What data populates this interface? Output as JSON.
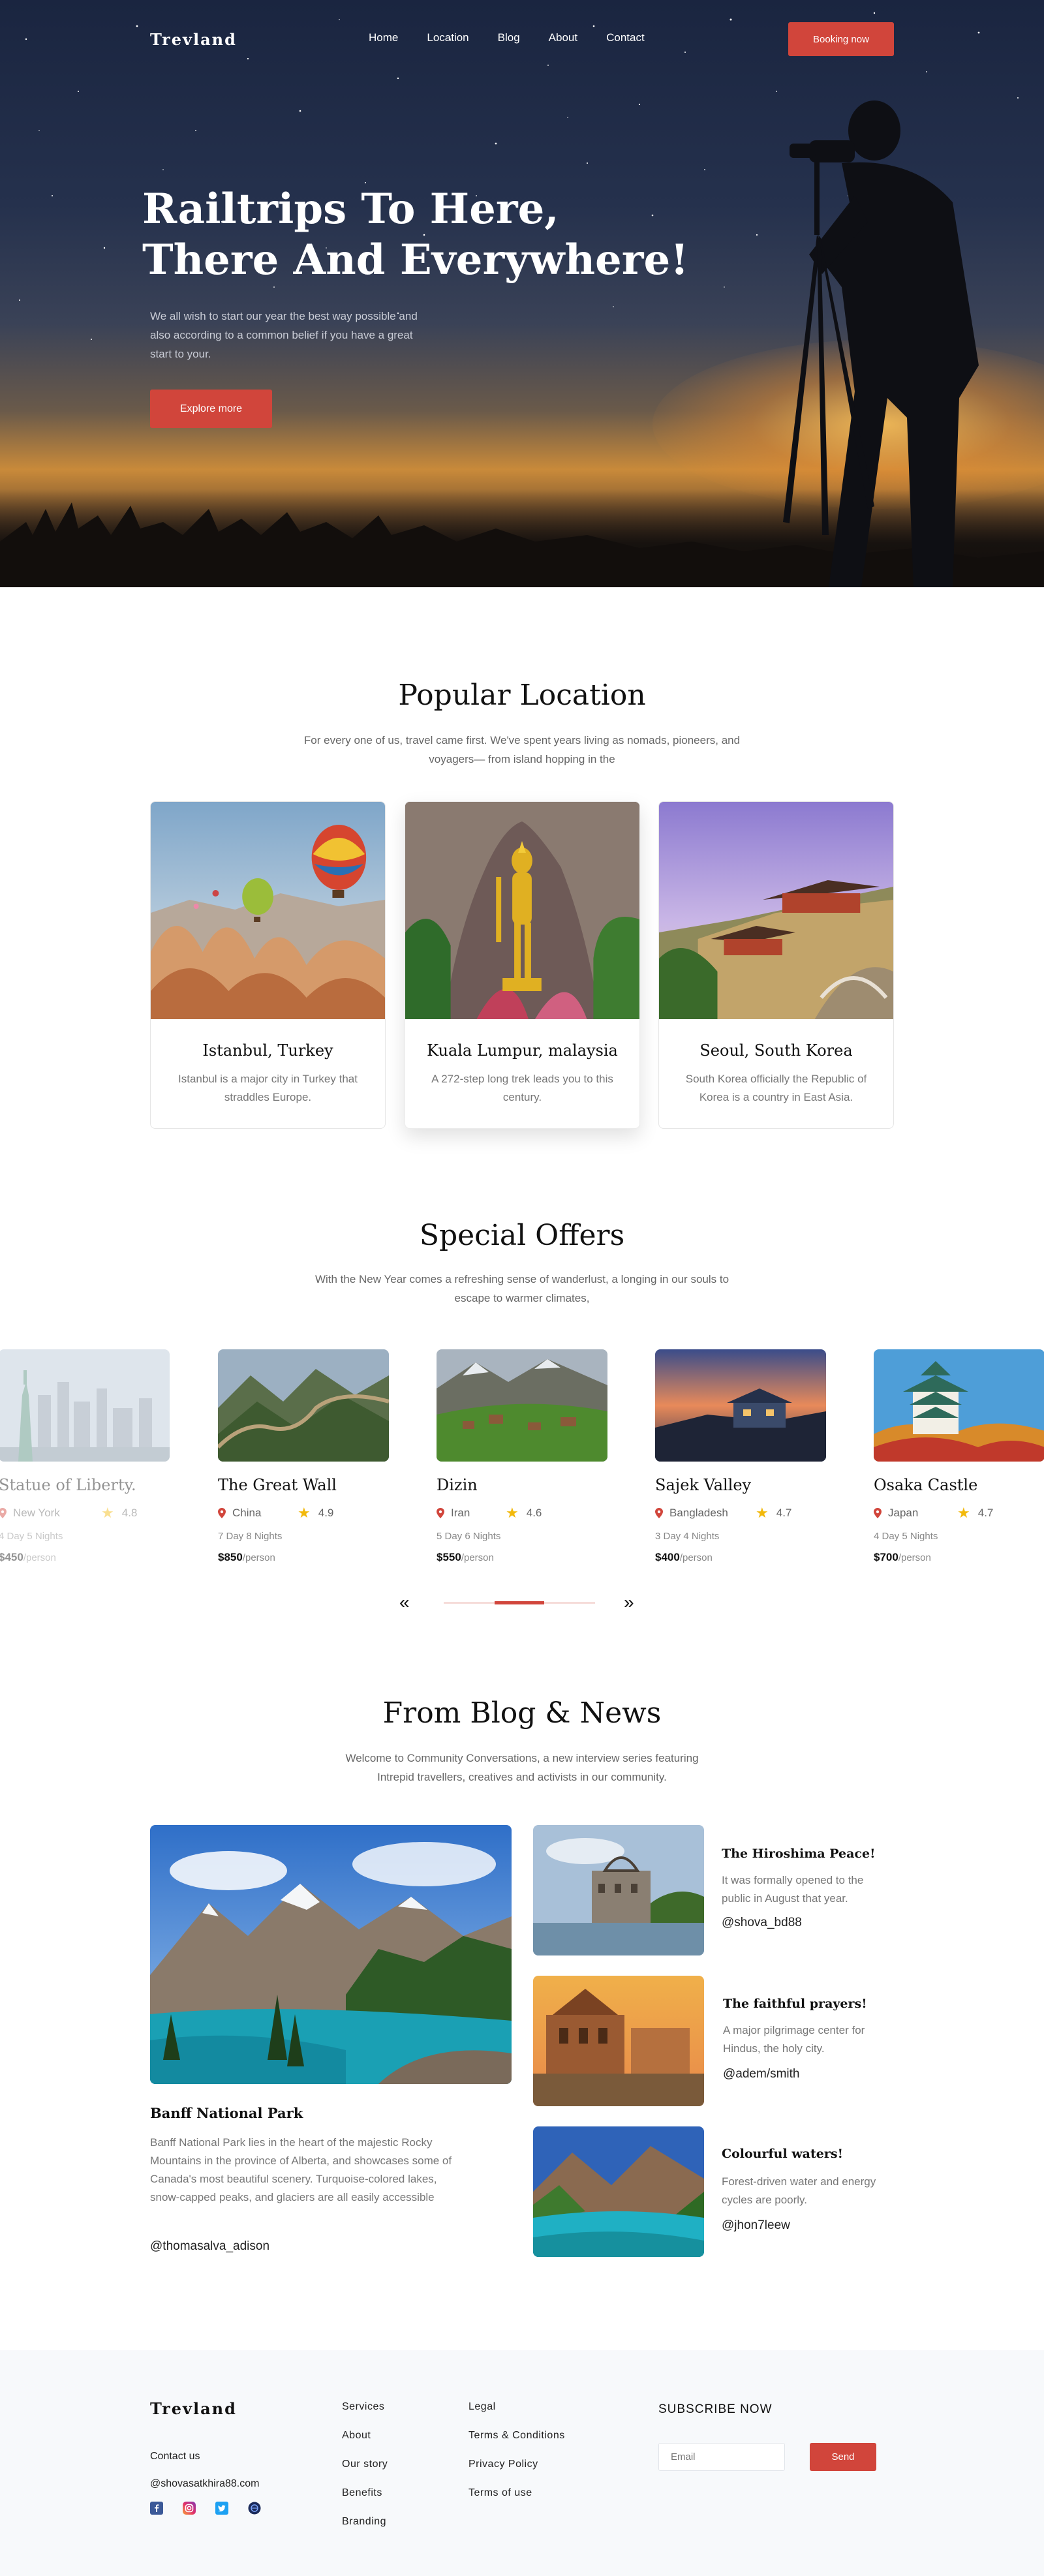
{
  "nav": {
    "logo": "Trevland",
    "items": [
      "Home",
      "Location",
      "Blog",
      "About",
      "Contact"
    ],
    "cta": "Booking now"
  },
  "hero": {
    "title_line1": "Railtrips To Here,",
    "title_line2": "There And Everywhere!",
    "lead": "We all wish to start our year the best way possible and also according to a common belief if you have a great start to your.",
    "cta": "Explore more"
  },
  "popular": {
    "title": "Popular Location",
    "subtitle": "For every one of us, travel came first. We've spent years living as nomads, pioneers, and voyagers— from island hopping in the",
    "cards": [
      {
        "title": "Istanbul, Turkey",
        "desc": "Istanbul is a major city in Turkey that straddles Europe."
      },
      {
        "title": "Kuala Lumpur, malaysia",
        "desc": "A 272-step long trek leads you to this century."
      },
      {
        "title": "Seoul, South Korea",
        "desc": "South Korea officially the Republic of Korea is a country in East Asia."
      }
    ]
  },
  "offers": {
    "title": "Special Offers",
    "subtitle": "With the New Year comes a refreshing sense of wanderlust, a longing in our souls to escape to warmer climates,",
    "per": "/person",
    "cards": [
      {
        "name": "Statue of Liberty.",
        "country": "New York",
        "rating": "4.8",
        "nights": "4 Day 5 Nights",
        "price": "$450"
      },
      {
        "name": "The Great Wall",
        "country": "China",
        "rating": "4.9",
        "nights": "7 Day 8 Nights",
        "price": "$850"
      },
      {
        "name": "Dizin",
        "country": "Iran",
        "rating": "4.6",
        "nights": "5 Day 6 Nights",
        "price": "$550"
      },
      {
        "name": "Sajek Valley",
        "country": "Bangladesh",
        "rating": "4.7",
        "nights": "3 Day 4 Nights",
        "price": "$400"
      },
      {
        "name": "Osaka Castle",
        "country": "Japan",
        "rating": "4.7",
        "nights": "4 Day 5 Nights",
        "price": "$700"
      }
    ],
    "prev": "«",
    "next": "»"
  },
  "blog": {
    "title": "From Blog & News",
    "subtitle": "Welcome to Community Conversations, a new interview series featuring Intrepid travellers, creatives and activists in our community.",
    "main": {
      "title": "Banff National Park",
      "desc": "Banff National Park lies in the heart of the majestic Rocky Mountains in the province of Alberta, and showcases some of Canada's most beautiful scenery. Turquoise-colored lakes, snow-capped peaks, and glaciers are all easily accessible",
      "author": "@thomasalva_adison"
    },
    "posts": [
      {
        "title": "The Hiroshima Peace!",
        "desc": "It was formally opened to the public in August that year.",
        "author": "@shova_bd88"
      },
      {
        "title": "The faithful prayers!",
        "desc": "A major pilgrimage center for Hindus, the holy city.",
        "author": "@adem/smith"
      },
      {
        "title": "Colourful waters!",
        "desc": "Forest-driven water and energy cycles are poorly.",
        "author": "@jhon7leew"
      }
    ]
  },
  "footer": {
    "logo": "Trevland",
    "contact_label": "Contact us",
    "email": "@shovasatkhira88.com",
    "col1": [
      "Services",
      "About",
      "Our story",
      "Benefits",
      "Branding"
    ],
    "col2": [
      "Legal",
      "Terms & Conditions",
      "Privacy Policy",
      "Terms of use"
    ],
    "subscribe_title": "SUBSCRIBE NOW",
    "email_placeholder": "Email",
    "send": "Send"
  },
  "colors": {
    "accent": "#d1453b",
    "star": "#f2b90c",
    "footer_bg": "#f7f9fb"
  }
}
